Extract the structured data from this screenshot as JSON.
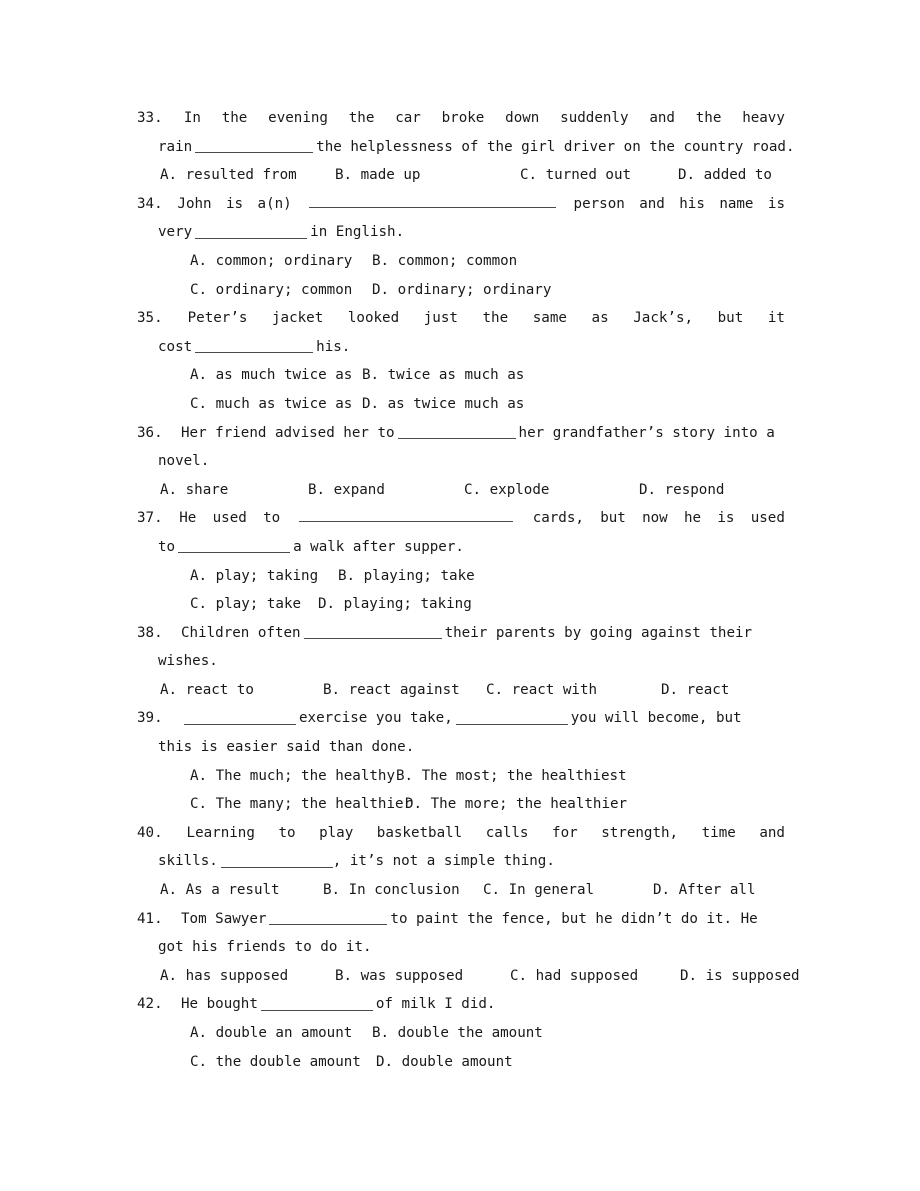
{
  "document": {
    "type": "english-grammar-multiple-choice-worksheet",
    "page_background": "#ffffff",
    "text_color": "#191919",
    "rule_color": "#4a4a4a"
  },
  "questions": [
    {
      "number": "33.",
      "stem_line1_words": [
        "In",
        "the",
        "evening",
        "the",
        "car",
        "broke",
        "down",
        "suddenly",
        "and",
        "the",
        "heavy"
      ],
      "stem_line2_pre": "rain",
      "stem_line2_post": "the helplessness of the girl driver on the country road.",
      "options_row1": [
        "A. resulted from",
        "B. made up",
        "C. turned out",
        "D. added to"
      ],
      "options_row2": []
    },
    {
      "number": "34.",
      "stem_line1_words": [
        "John",
        "is",
        "a(n)",
        "",
        "person",
        "and",
        "his",
        "name",
        "is"
      ],
      "stem_line2_pre": "very",
      "stem_line2_post": "in English.",
      "options_row1": [
        "A. common; ordinary",
        "B. common; common"
      ],
      "options_row2": [
        "C. ordinary; common",
        "D. ordinary; ordinary"
      ]
    },
    {
      "number": "35.",
      "stem_line1_words": [
        "Peter’s",
        "jacket",
        "looked",
        "just",
        "the",
        "same",
        "as",
        "Jack’s,",
        "but",
        "it"
      ],
      "stem_line2_pre": "cost",
      "stem_line2_post": "his.",
      "options_row1": [
        "A. as much twice as",
        "B. twice as much as"
      ],
      "options_row2": [
        "C. much as twice as",
        "D. as twice much as"
      ]
    },
    {
      "number": "36.",
      "stem_line1_pre": "Her friend advised her to",
      "stem_line1_post": "her grandfather’s story into a",
      "stem_line2": "novel.",
      "options_row1": [
        "A. share",
        "B. expand",
        "C. explode",
        "D. respond"
      ],
      "options_row2": []
    },
    {
      "number": "37.",
      "stem_line1_words": [
        "He",
        "used",
        "to",
        "",
        "cards,",
        "but",
        "now",
        "he",
        "is",
        "used"
      ],
      "stem_line2_pre": "to",
      "stem_line2_post": "a walk after supper.",
      "options_row1": [
        "A. play; taking",
        "B. playing; take"
      ],
      "options_row2": [
        "C. play; take",
        "D. playing; taking"
      ]
    },
    {
      "number": "38.",
      "stem_line1_pre": "Children often",
      "stem_line1_post": "their parents by going against their",
      "stem_line2": "wishes.",
      "options_row1": [
        "A. react to",
        "B. react against",
        "C. react with",
        "D. react"
      ],
      "options_row2": []
    },
    {
      "number": "39.",
      "stem_line1_pre": "",
      "stem_line1_mid": "exercise you take,",
      "stem_line1_post": "you will become, but",
      "stem_line2": "this is easier said than done.",
      "options_row1": [
        "A. The much; the healthy",
        "B. The most; the healthiest"
      ],
      "options_row2": [
        "C. The many; the healthier",
        "D. The more; the healthier"
      ]
    },
    {
      "number": "40.",
      "stem_line1_words": [
        "Learning",
        "to",
        "play",
        "basketball",
        "calls",
        "for",
        "strength,",
        "time",
        "and"
      ],
      "stem_line2_pre": "skills.",
      "stem_line2_post": ", it’s not a simple thing.",
      "options_row1": [
        "A. As a result",
        "B. In conclusion",
        "C. In general",
        "D. After all"
      ],
      "options_row2": []
    },
    {
      "number": "41.",
      "stem_line1_pre": "Tom Sawyer",
      "stem_line1_post": "to paint the fence, but he didn’t do it. He",
      "stem_line2": "got his friends to do it.",
      "options_row1": [
        "A. has supposed",
        "B. was supposed",
        "C. had supposed",
        "D. is supposed"
      ],
      "options_row2": []
    },
    {
      "number": "42.",
      "stem_line1_pre": "He bought",
      "stem_line1_post": "of milk I did.",
      "stem_line2": "",
      "options_row1": [
        "A. double an amount",
        "B. double the amount"
      ],
      "options_row2": [
        "C. the double amount",
        "D. double amount"
      ]
    }
  ]
}
